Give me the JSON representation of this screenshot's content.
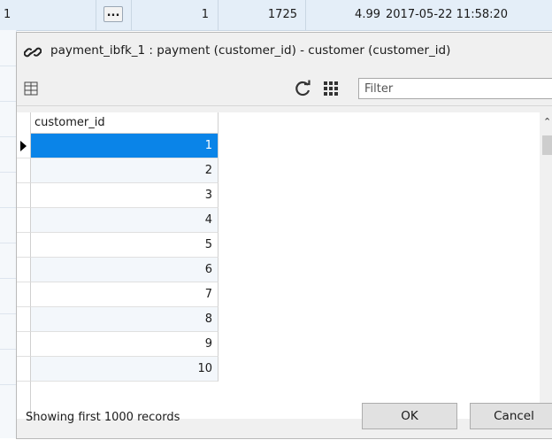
{
  "background_row": {
    "row_number": "1",
    "ellipsis_label": "...",
    "col_1": "1",
    "col_2": "1725",
    "col_3": "4.99",
    "col_4": "2017-05-22 11:58:20"
  },
  "popup": {
    "title": "payment_ibfk_1 : payment (customer_id) - customer (customer_id)",
    "filter_placeholder": "Filter",
    "column_header": "customer_id",
    "rows": [
      "1",
      "2",
      "3",
      "4",
      "5",
      "6",
      "7",
      "8",
      "9",
      "10"
    ],
    "selected_index": 0,
    "status": "Showing first 1000 records",
    "ok_label": "OK",
    "cancel_label": "Cancel"
  },
  "icons": {
    "title": "link-icon",
    "toolbar_left": "columns-icon",
    "refresh": "refresh-icon",
    "grid_toggle": "grid-icon"
  },
  "colors": {
    "selection": "#0a84e8",
    "background_row": "#e4eef8",
    "dialog_bg": "#f0f0f0"
  }
}
